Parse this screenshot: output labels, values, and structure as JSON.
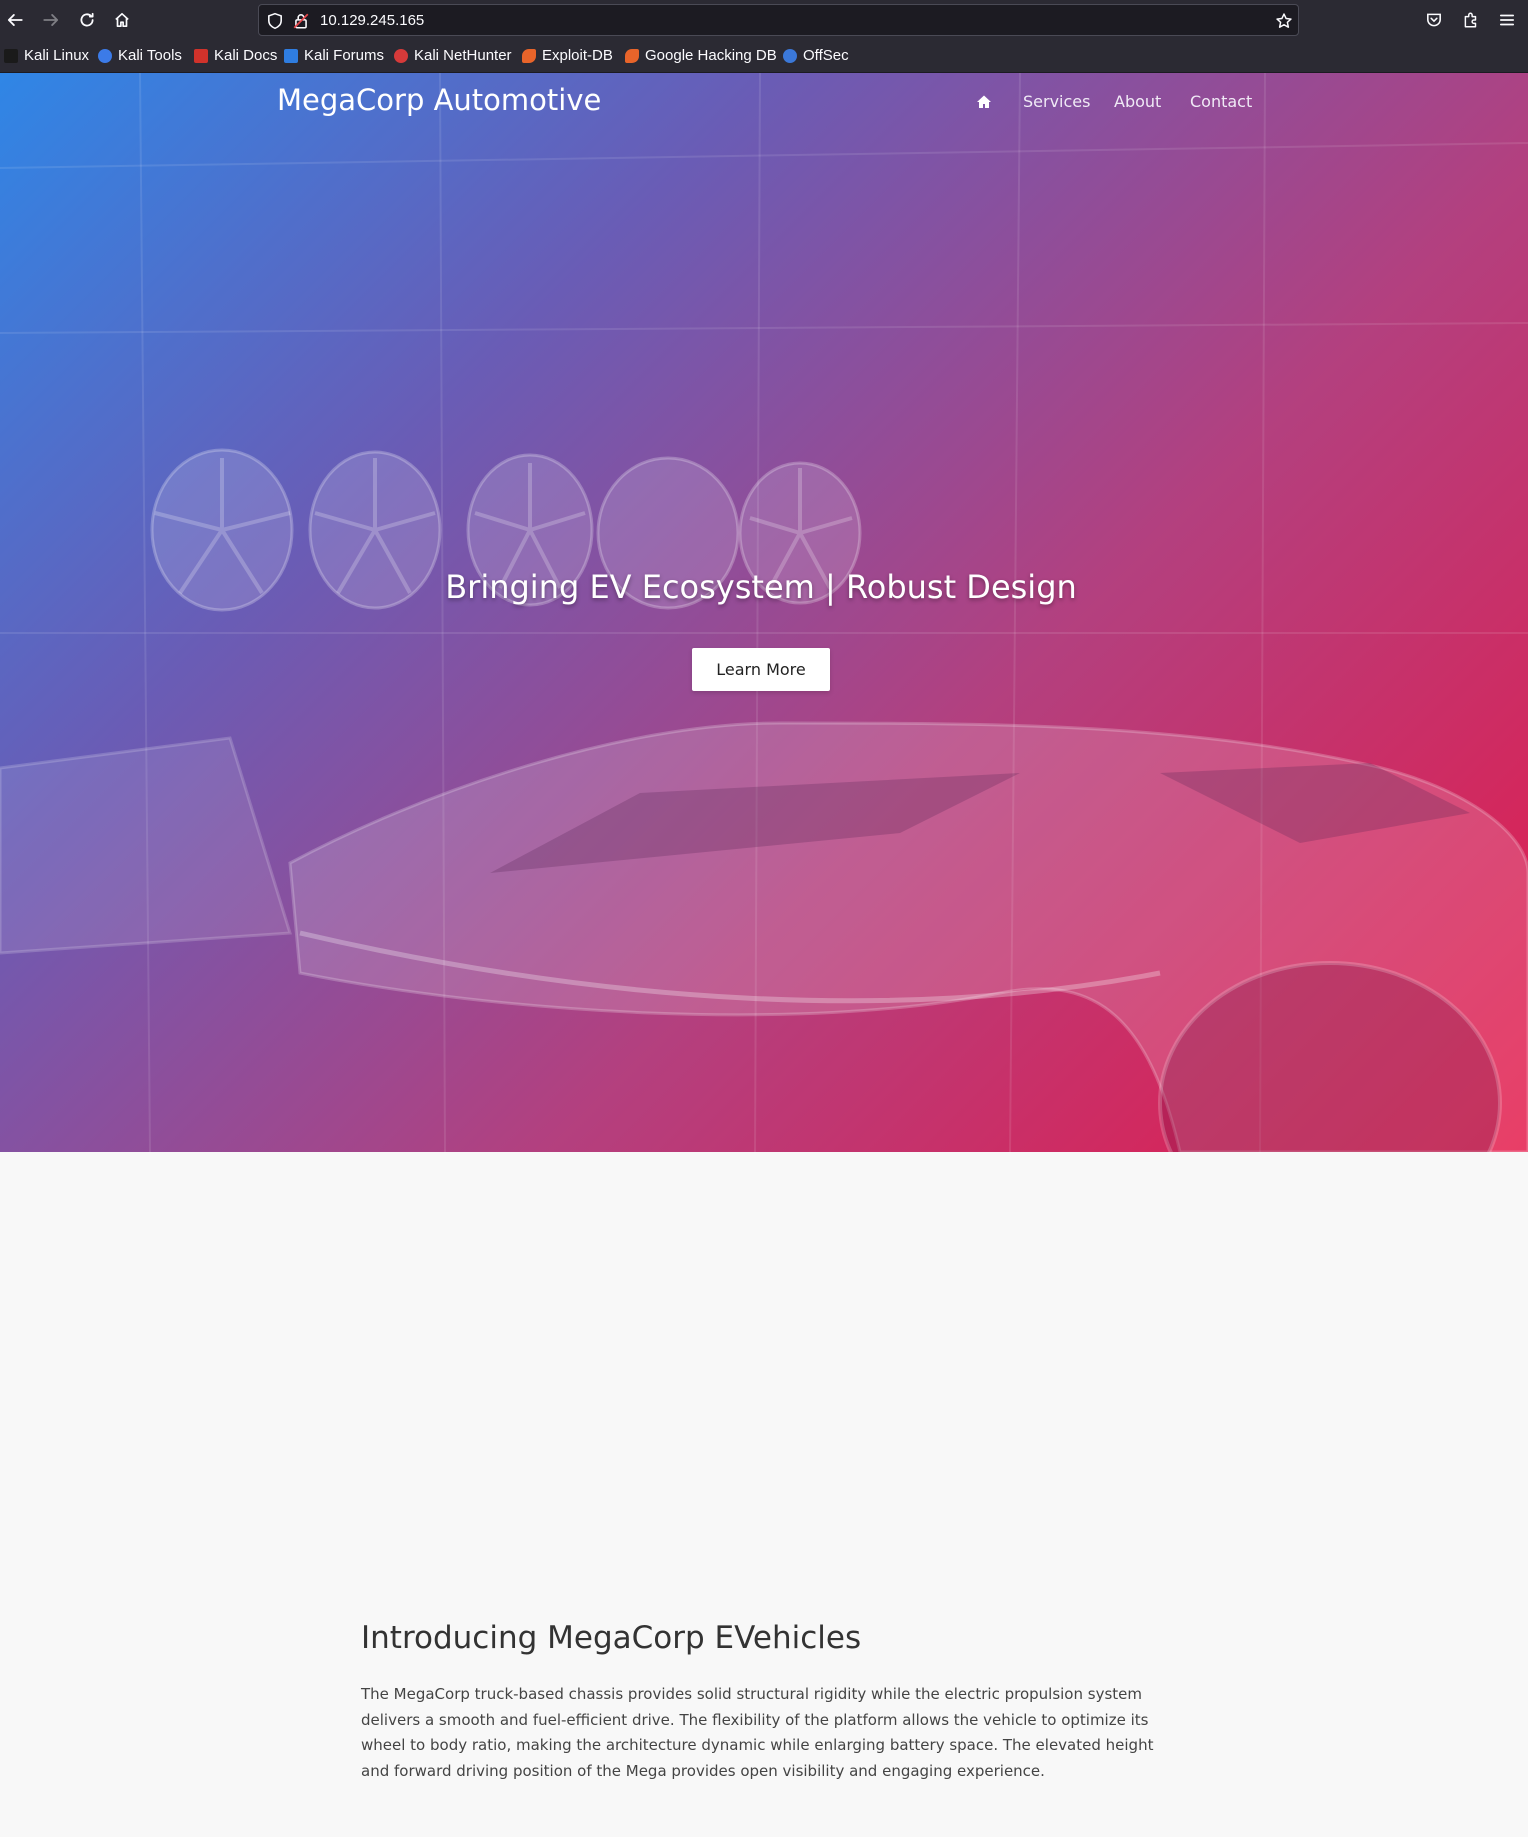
{
  "browser": {
    "url": "10.129.245.165",
    "bookmarks": [
      {
        "label": "Kali Linux",
        "color": "#1a1a1a"
      },
      {
        "label": "Kali Tools",
        "color": "#3c7be8"
      },
      {
        "label": "Kali Docs",
        "color": "#d0322b"
      },
      {
        "label": "Kali Forums",
        "color": "#2f7de1"
      },
      {
        "label": "Kali NetHunter",
        "color": "#d63a3a"
      },
      {
        "label": "Exploit-DB",
        "color": "#e8642a"
      },
      {
        "label": "Google Hacking DB",
        "color": "#e8642a"
      },
      {
        "label": "OffSec",
        "color": "#3b78d9"
      }
    ]
  },
  "site": {
    "brand": "MegaCorp Automotive",
    "nav": {
      "home_icon": "home-icon",
      "services": "Services",
      "about": "About",
      "contact": "Contact"
    },
    "hero": {
      "title": "Bringing EV Ecosystem | Robust Design",
      "button": "Learn More",
      "gradient": [
        "#2f86e6",
        "#6a5cb5",
        "#b3407f",
        "#e51a4a"
      ]
    },
    "intro": {
      "title": "Introducing MegaCorp EVehicles",
      "text": "The MegaCorp truck-based chassis provides solid structural rigidity while the electric propulsion system delivers a smooth and fuel-efficient drive. The flexibility of the platform allows the vehicle to optimize its wheel to body ratio, making the architecture dynamic while enlarging battery space. The elevated height and forward driving position of the Mega provides open visibility and engaging experience."
    }
  }
}
